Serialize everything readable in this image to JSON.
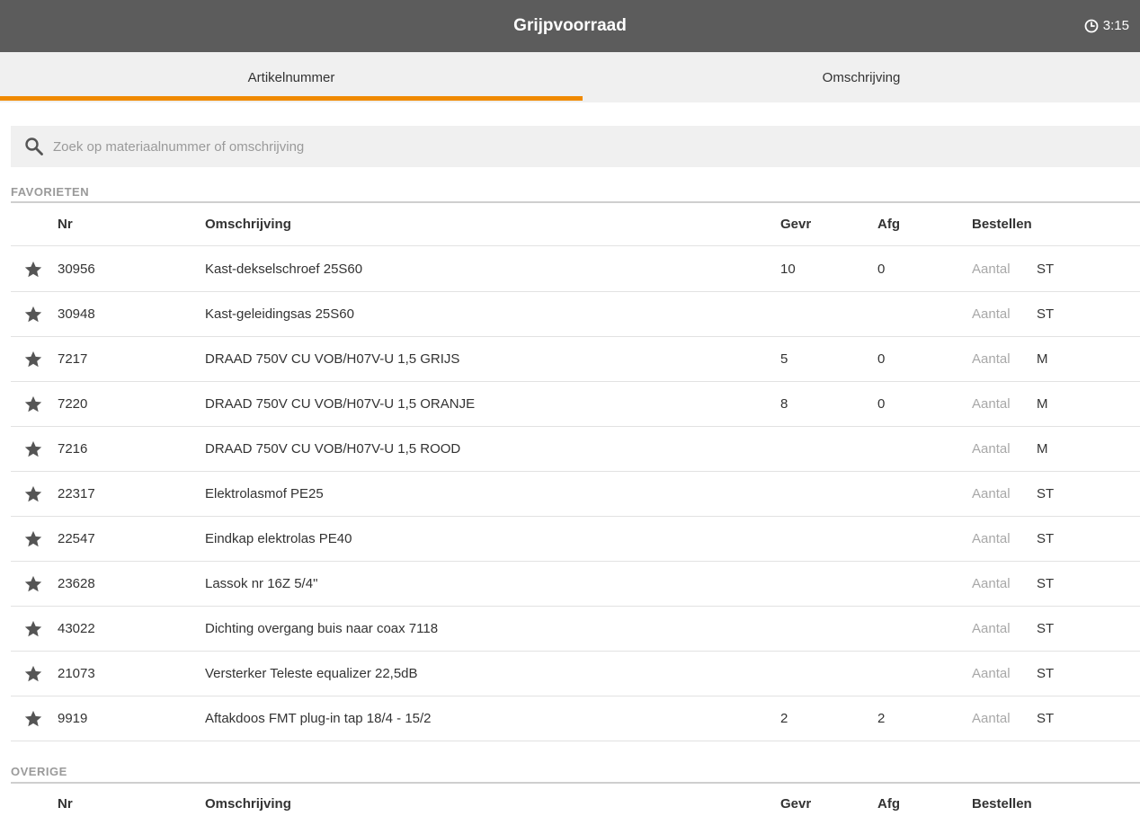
{
  "header": {
    "title": "Grijpvoorraad",
    "time": "3:15"
  },
  "tabs": [
    {
      "label": "Artikelnummer",
      "active": true
    },
    {
      "label": "Omschrijving",
      "active": false
    }
  ],
  "search": {
    "placeholder": "Zoek op materiaalnummer of omschrijving",
    "value": ""
  },
  "columns": {
    "nr": "Nr",
    "description": "Omschrijving",
    "requested": "Gevr",
    "delivered": "Afg",
    "order": "Bestellen"
  },
  "favorites": {
    "label": "FAVORIETEN",
    "rows": [
      {
        "nr": "30956",
        "description": "Kast-dekselschroef 25S60",
        "requested": "10",
        "delivered": "0",
        "quantity_placeholder": "Aantal",
        "unit": "ST"
      },
      {
        "nr": "30948",
        "description": "Kast-geleidingsas 25S60",
        "requested": "",
        "delivered": "",
        "quantity_placeholder": "Aantal",
        "unit": "ST"
      },
      {
        "nr": "7217",
        "description": "DRAAD 750V CU VOB/H07V-U 1,5 GRIJS",
        "requested": "5",
        "delivered": "0",
        "quantity_placeholder": "Aantal",
        "unit": "M"
      },
      {
        "nr": "7220",
        "description": "DRAAD 750V CU VOB/H07V-U 1,5 ORANJE",
        "requested": "8",
        "delivered": "0",
        "quantity_placeholder": "Aantal",
        "unit": "M"
      },
      {
        "nr": "7216",
        "description": "DRAAD 750V CU VOB/H07V-U 1,5 ROOD",
        "requested": "",
        "delivered": "",
        "quantity_placeholder": "Aantal",
        "unit": "M"
      },
      {
        "nr": "22317",
        "description": "Elektrolasmof PE25",
        "requested": "",
        "delivered": "",
        "quantity_placeholder": "Aantal",
        "unit": "ST"
      },
      {
        "nr": "22547",
        "description": "Eindkap elektrolas PE40",
        "requested": "",
        "delivered": "",
        "quantity_placeholder": "Aantal",
        "unit": "ST"
      },
      {
        "nr": "23628",
        "description": "Lassok nr 16Z 5/4\"",
        "requested": "",
        "delivered": "",
        "quantity_placeholder": "Aantal",
        "unit": "ST"
      },
      {
        "nr": "43022",
        "description": "Dichting overgang buis naar coax 7118",
        "requested": "",
        "delivered": "",
        "quantity_placeholder": "Aantal",
        "unit": "ST"
      },
      {
        "nr": "21073",
        "description": "Versterker Teleste equalizer 22,5dB",
        "requested": "",
        "delivered": "",
        "quantity_placeholder": "Aantal",
        "unit": "ST"
      },
      {
        "nr": "9919",
        "description": "Aftakdoos FMT plug-in tap 18/4 - 15/2",
        "requested": "2",
        "delivered": "2",
        "quantity_placeholder": "Aantal",
        "unit": "ST"
      }
    ]
  },
  "other": {
    "label": "OVERIGE"
  },
  "colors": {
    "header_bg": "#5c5c5c",
    "tab_bg": "#f0f0f0",
    "accent": "#f08a00",
    "star": "#555555"
  },
  "icons": {
    "clock": "clock-icon",
    "search": "search-icon",
    "favorite": "star-icon"
  }
}
